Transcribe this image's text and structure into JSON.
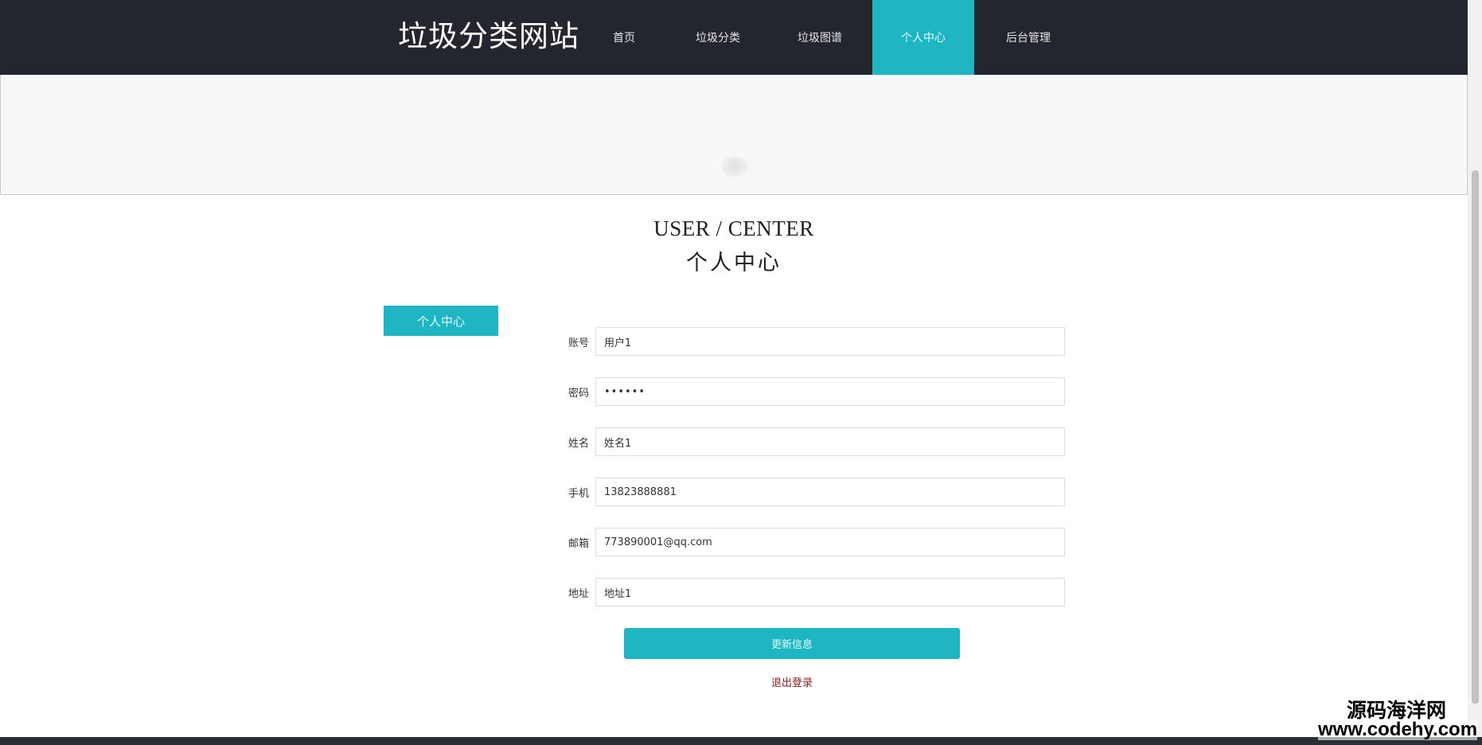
{
  "header": {
    "site_title": "垃圾分类网站",
    "nav": [
      {
        "label": "首页"
      },
      {
        "label": "垃圾分类"
      },
      {
        "label": "垃圾图谱"
      },
      {
        "label": "个人中心",
        "active": true
      },
      {
        "label": "后台管理"
      }
    ]
  },
  "heading": {
    "en": "USER / CENTER",
    "cn": "个人中心"
  },
  "sidebar": {
    "tab_label": "个人中心"
  },
  "form": {
    "fields": [
      {
        "label": "账号",
        "value": "用户1"
      },
      {
        "label": "密码",
        "value": "••••••"
      },
      {
        "label": "姓名",
        "value": "姓名1"
      },
      {
        "label": "手机",
        "value": "13823888881"
      },
      {
        "label": "邮箱",
        "value": "773890001@qq.com"
      },
      {
        "label": "地址",
        "value": "地址1"
      }
    ],
    "submit_label": "更新信息",
    "logout_label": "退出登录"
  },
  "watermark": {
    "cn": "源码海洋网",
    "url": "www.codehy.com"
  },
  "colors": {
    "header_bg": "#23262f",
    "accent": "#1fb6c4",
    "logout_text": "#8b1a1a"
  }
}
